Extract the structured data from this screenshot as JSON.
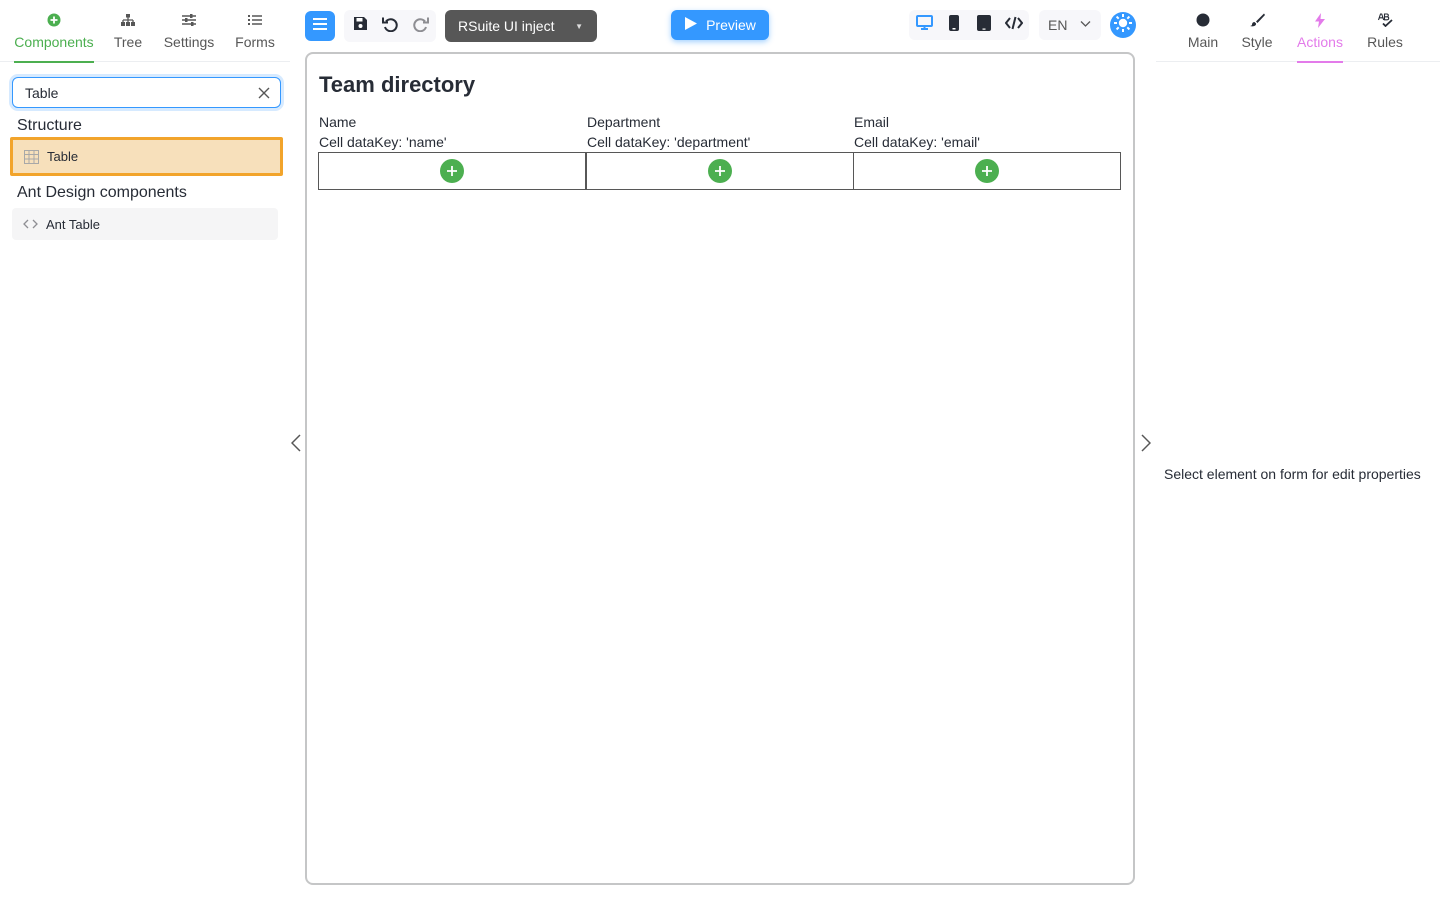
{
  "left_tabs": [
    {
      "label": "Components",
      "icon": "plus-circle-icon",
      "active": true
    },
    {
      "label": "Tree",
      "icon": "tree-icon",
      "active": false
    },
    {
      "label": "Settings",
      "icon": "sliders-icon",
      "active": false
    },
    {
      "label": "Forms",
      "icon": "list-icon",
      "active": false
    }
  ],
  "search": {
    "value": "Table"
  },
  "groups": [
    {
      "title": "Structure",
      "items": [
        {
          "label": "Table",
          "icon": "table-icon",
          "highlighted": true
        }
      ]
    },
    {
      "title": "Ant Design components",
      "items": [
        {
          "label": "Ant Table",
          "icon": "code-icon",
          "highlighted": false
        }
      ]
    }
  ],
  "toolbar": {
    "preset_label": "RSuite UI inject",
    "preview_label": "Preview",
    "language": "EN"
  },
  "canvas": {
    "title": "Team directory",
    "columns": [
      {
        "header": "Name",
        "key_text": "Cell dataKey: 'name'"
      },
      {
        "header": "Department",
        "key_text": "Cell dataKey: 'department'"
      },
      {
        "header": "Email",
        "key_text": "Cell dataKey: 'email'"
      }
    ]
  },
  "right_tabs": [
    {
      "label": "Main",
      "icon": "circle-icon",
      "active": false
    },
    {
      "label": "Style",
      "icon": "brush-icon",
      "active": false
    },
    {
      "label": "Actions",
      "icon": "lightning-icon",
      "active": true
    },
    {
      "label": "Rules",
      "icon": "spellcheck-icon",
      "active": false
    }
  ],
  "right_panel": {
    "message": "Select element on form for edit properties"
  },
  "colors": {
    "accent_green": "#4caf50",
    "accent_blue": "#3498ff",
    "highlight_orange": "#f2a42b",
    "actions_pink": "#e37bea"
  }
}
